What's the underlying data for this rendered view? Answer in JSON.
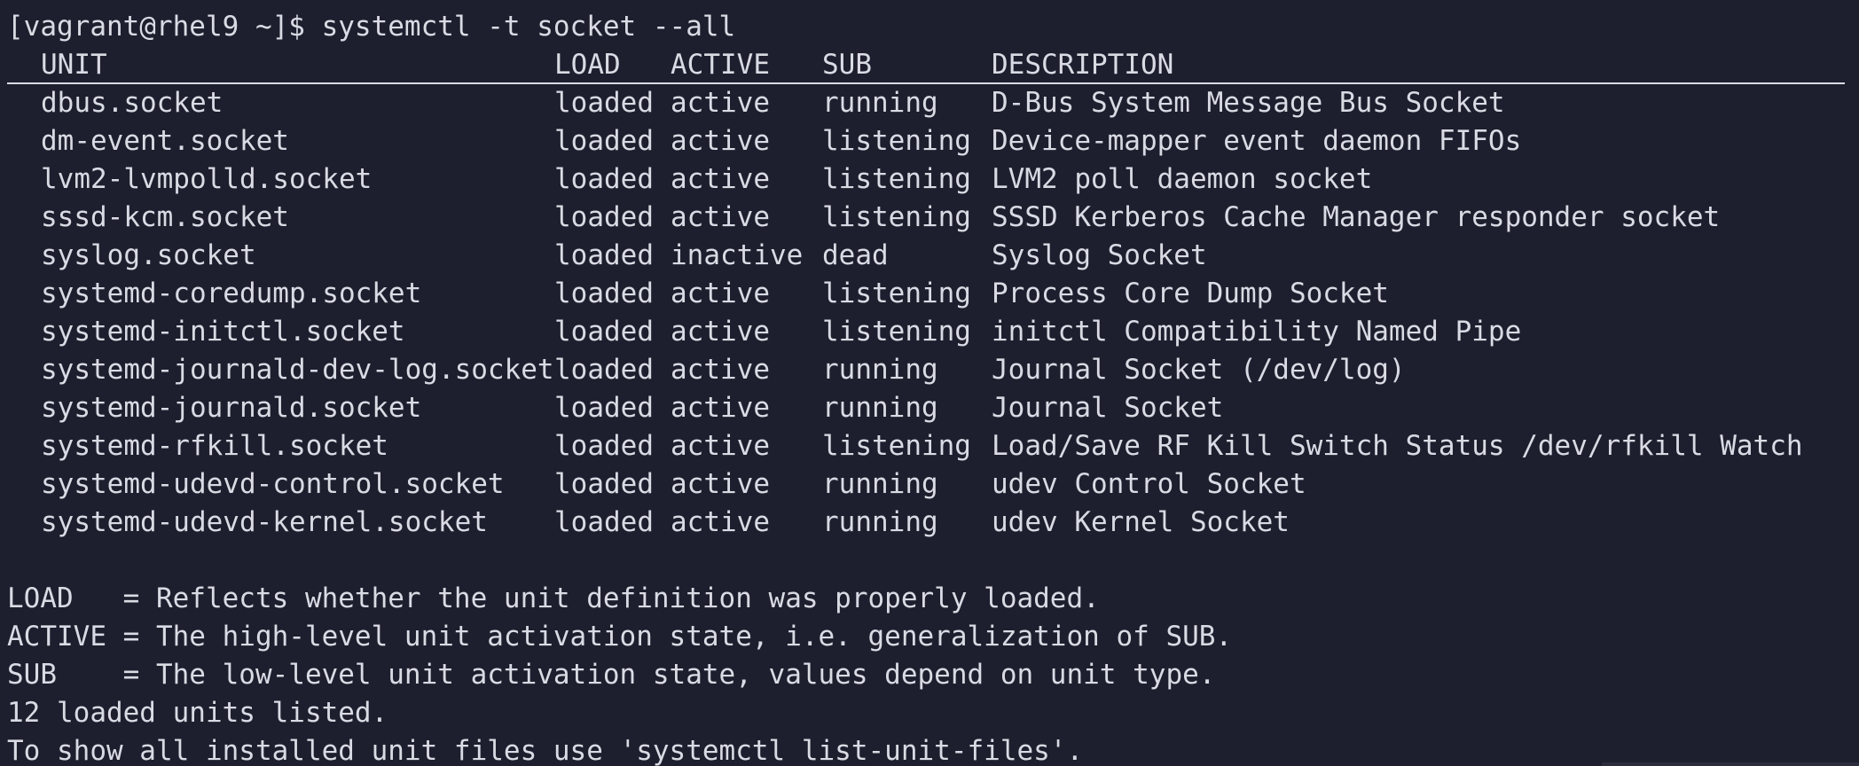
{
  "terminal": {
    "prompt": "[vagrant@rhel9 ~]$ systemctl -t socket --all",
    "headers": {
      "unit": "UNIT",
      "load": "LOAD",
      "active": "ACTIVE",
      "sub": "SUB",
      "description": "DESCRIPTION"
    },
    "rows": [
      {
        "unit": "dbus.socket",
        "load": "loaded",
        "active": "active",
        "sub": "running",
        "description": "D-Bus System Message Bus Socket"
      },
      {
        "unit": "dm-event.socket",
        "load": "loaded",
        "active": "active",
        "sub": "listening",
        "description": "Device-mapper event daemon FIFOs"
      },
      {
        "unit": "lvm2-lvmpolld.socket",
        "load": "loaded",
        "active": "active",
        "sub": "listening",
        "description": "LVM2 poll daemon socket"
      },
      {
        "unit": "sssd-kcm.socket",
        "load": "loaded",
        "active": "active",
        "sub": "listening",
        "description": "SSSD Kerberos Cache Manager responder socket"
      },
      {
        "unit": "syslog.socket",
        "load": "loaded",
        "active": "inactive",
        "sub": "dead",
        "description": "Syslog Socket"
      },
      {
        "unit": "systemd-coredump.socket",
        "load": "loaded",
        "active": "active",
        "sub": "listening",
        "description": "Process Core Dump Socket"
      },
      {
        "unit": "systemd-initctl.socket",
        "load": "loaded",
        "active": "active",
        "sub": "listening",
        "description": "initctl Compatibility Named Pipe"
      },
      {
        "unit": "systemd-journald-dev-log.socket",
        "load": "loaded",
        "active": "active",
        "sub": "running",
        "description": "Journal Socket (/dev/log)"
      },
      {
        "unit": "systemd-journald.socket",
        "load": "loaded",
        "active": "active",
        "sub": "running",
        "description": "Journal Socket"
      },
      {
        "unit": "systemd-rfkill.socket",
        "load": "loaded",
        "active": "active",
        "sub": "listening",
        "description": "Load/Save RF Kill Switch Status /dev/rfkill Watch"
      },
      {
        "unit": "systemd-udevd-control.socket",
        "load": "loaded",
        "active": "active",
        "sub": "running",
        "description": "udev Control Socket"
      },
      {
        "unit": "systemd-udevd-kernel.socket",
        "load": "loaded",
        "active": "active",
        "sub": "running",
        "description": "udev Kernel Socket"
      }
    ],
    "legend": {
      "load": "LOAD   = Reflects whether the unit definition was properly loaded.",
      "active": "ACTIVE = The high-level unit activation state, i.e. generalization of SUB.",
      "sub": "SUB    = The low-level unit activation state, values depend on unit type."
    },
    "summary": "12 loaded units listed.",
    "hint": "To show all installed unit files use 'systemctl list-unit-files'."
  },
  "colors": {
    "background": "#1e1f2e",
    "foreground": "#d9dbe4"
  }
}
